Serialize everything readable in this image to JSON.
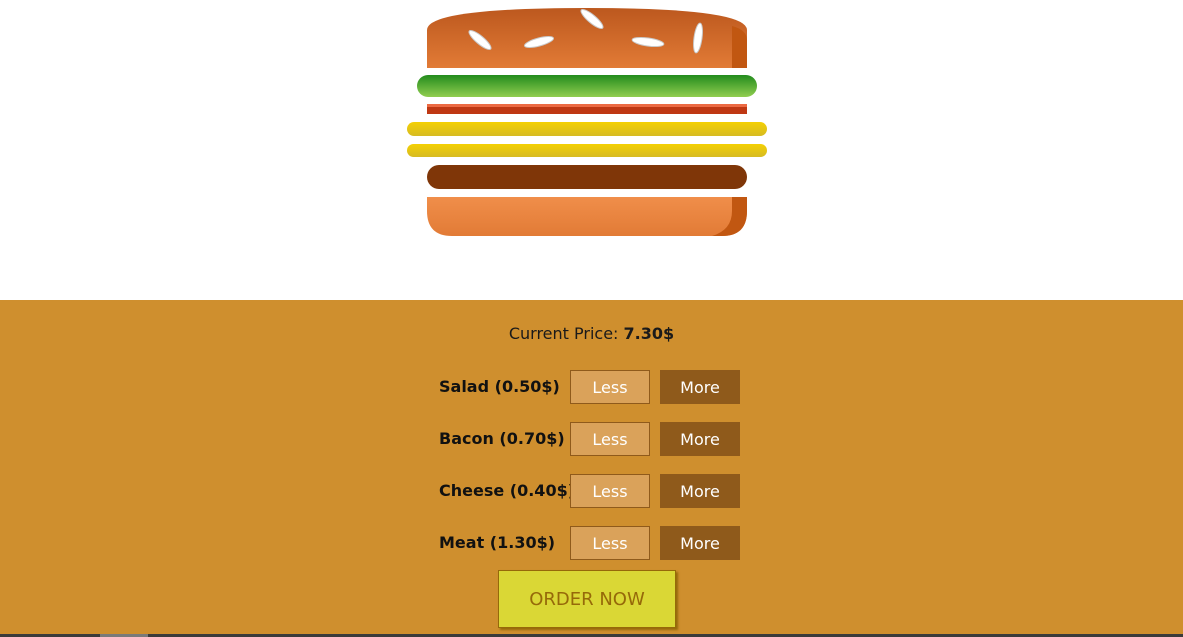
{
  "burger": {
    "colors": {
      "bread": "#e27b36",
      "bread_dark": "#c15711",
      "salad": "#4caf50",
      "salad_dark": "#228c1d",
      "bacon": "#bf3813",
      "cheese": "#f4d004",
      "cheese_dark": "#d6bb22",
      "meat": "#7f3608",
      "meat_dark": "#702e05",
      "seed": "#ffffff"
    },
    "layers": [
      "bread-top",
      "salad",
      "bacon",
      "cheese",
      "cheese",
      "meat",
      "bread-bottom"
    ]
  },
  "controls": {
    "price_label": "Current Price: ",
    "price_value": "7.30$",
    "less_label": "Less",
    "more_label": "More",
    "ingredients": [
      {
        "label": "Salad (0.50$)"
      },
      {
        "label": "Bacon (0.70$)"
      },
      {
        "label": "Cheese (0.40$)"
      },
      {
        "label": "Meat (1.30$)"
      }
    ],
    "order_label": "ORDER NOW",
    "colors": {
      "panel_bg": "#cf8f2e",
      "less_bg": "#daa25a",
      "more_bg": "#8f5a1b",
      "order_bg": "#dad735",
      "order_text": "#966909"
    }
  }
}
